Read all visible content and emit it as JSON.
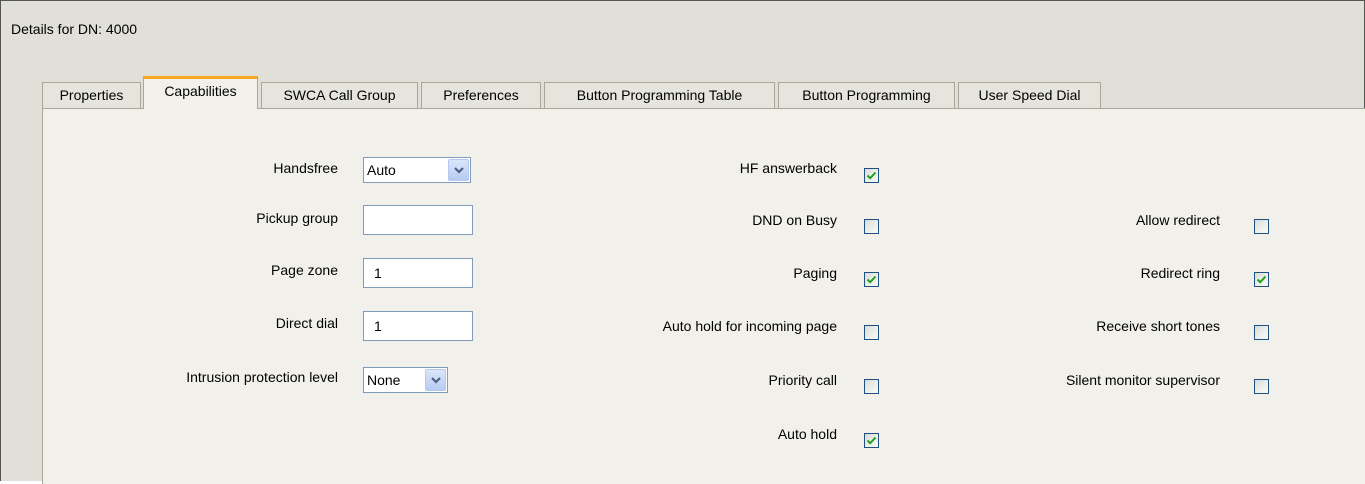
{
  "header": {
    "title": "Details for DN: 4000"
  },
  "tabs": [
    {
      "label": "Properties",
      "active": false
    },
    {
      "label": "Capabilities",
      "active": true
    },
    {
      "label": "SWCA Call Group",
      "active": false
    },
    {
      "label": "Preferences",
      "active": false
    },
    {
      "label": "Button Programming Table",
      "active": false
    },
    {
      "label": "Button Programming",
      "active": false
    },
    {
      "label": "User Speed Dial",
      "active": false
    }
  ],
  "left": {
    "handsfree": {
      "label": "Handsfree",
      "value": "Auto"
    },
    "pickup_group": {
      "label": "Pickup group",
      "value": ""
    },
    "page_zone": {
      "label": "Page zone",
      "value": "1"
    },
    "direct_dial": {
      "label": "Direct dial",
      "value": "1"
    },
    "intrusion": {
      "label": "Intrusion protection level",
      "value": "None"
    }
  },
  "middle": [
    {
      "label": "HF answerback",
      "checked": true
    },
    {
      "label": "DND on Busy",
      "checked": false
    },
    {
      "label": "Paging",
      "checked": true
    },
    {
      "label": "Auto hold for incoming page",
      "checked": false
    },
    {
      "label": "Priority call",
      "checked": false
    },
    {
      "label": "Auto hold",
      "checked": true
    }
  ],
  "right": [
    {
      "label": "Allow redirect",
      "checked": false
    },
    {
      "label": "Redirect ring",
      "checked": true
    },
    {
      "label": "Receive short tones",
      "checked": false
    },
    {
      "label": "Silent monitor supervisor",
      "checked": false
    }
  ],
  "icons": {
    "dropdown": "chevron-down-icon",
    "check": "check-icon"
  },
  "colors": {
    "active_tab_accent": "#f5a623",
    "checkmark": "#21a121",
    "checkbox_border": "#1c5180"
  }
}
